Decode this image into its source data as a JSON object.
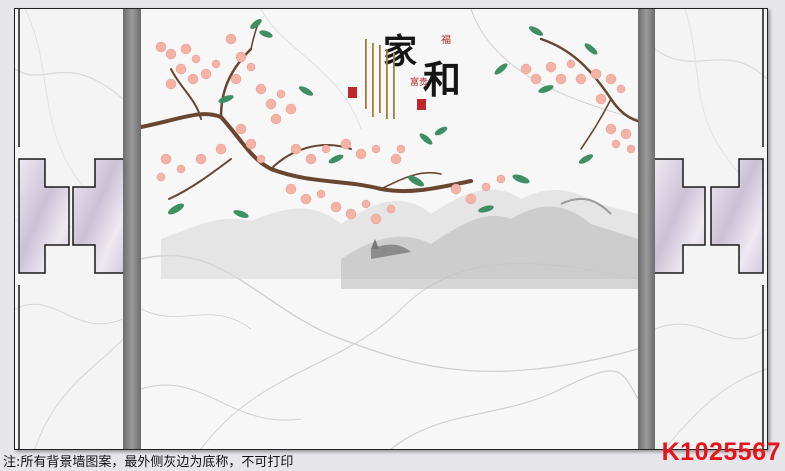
{
  "caption": "注:所有背景墙图案，最外侧灰边为底称，不可打印",
  "product_code": "K1025567",
  "artwork": {
    "title_char_1": "家",
    "title_char_2": "和",
    "red_mark": "富贵",
    "stamp_char": "福"
  },
  "colors": {
    "code_red": "#e8141c",
    "strip_gray": "#8a8a8a",
    "blossom_pink": "#f4b3a6",
    "leaf_green": "#3f8f64"
  }
}
